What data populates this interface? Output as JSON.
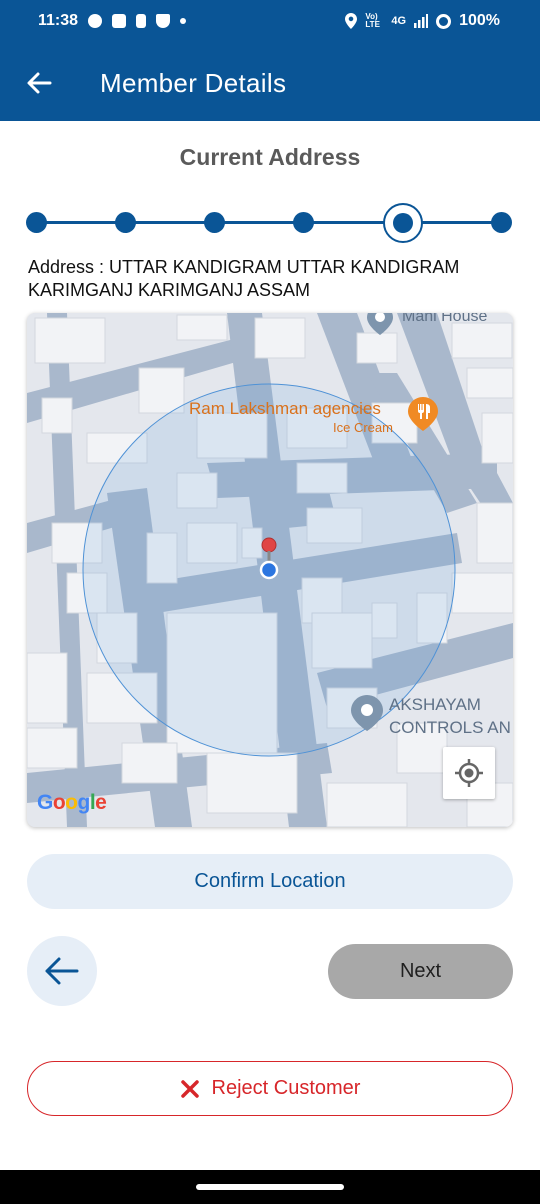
{
  "status_bar": {
    "time": "11:38",
    "network_label": "Vo) LTE",
    "network_type": "4G",
    "battery": "100%"
  },
  "app_bar": {
    "title": "Member Details",
    "back_icon": "arrow-left-icon"
  },
  "section_title": "Current Address",
  "stepper": {
    "total_steps": 6,
    "active_step": 5
  },
  "address_text": "Address : UTTAR KANDIGRAM UTTAR KANDIGRAM KARIMGANJ KARIMGANJ ASSAM",
  "map": {
    "poi_top": "Mani House",
    "poi_restaurant_name": "Ram Lakshman agencies",
    "poi_restaurant_category": "Ice Cream",
    "poi_business_line1": "AKSHAYAM",
    "poi_business_line2": "CONTROLS AN",
    "attribution": "Google",
    "locate_icon": "my-location-icon"
  },
  "buttons": {
    "confirm": "Confirm Location",
    "next": "Next",
    "reject": "Reject Customer",
    "prev_icon": "arrow-left-icon",
    "reject_icon": "close-x-icon"
  },
  "colors": {
    "primary": "#0a5596",
    "reject": "#d7262a",
    "confirm_bg": "#e6eef7",
    "next_bg": "#a8a8a8"
  }
}
